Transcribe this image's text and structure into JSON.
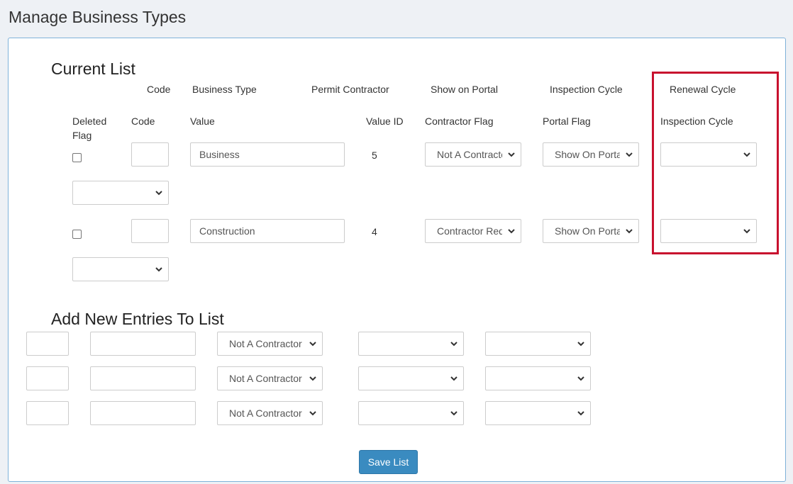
{
  "page": {
    "title": "Manage Business Types"
  },
  "current_list": {
    "title": "Current List",
    "header_row1": [
      "Code",
      "Business Type",
      "Permit Contractor",
      "Show on Portal",
      "Inspection Cycle",
      "Renewal Cycle"
    ],
    "header_row2": [
      "Deleted\nFlag",
      "Code",
      "Value",
      "Value ID",
      "Contractor Flag",
      "Portal Flag",
      "Inspection Cycle"
    ],
    "rows": [
      {
        "deleted": false,
        "code": "",
        "value": "Business",
        "value_id": "5",
        "contractor_flag": "Not A Contractor",
        "portal_flag": "Show On Portal",
        "inspection_cycle": "",
        "renewal_cycle": ""
      },
      {
        "deleted": false,
        "code": "",
        "value": "Construction",
        "value_id": "4",
        "contractor_flag": "Contractor Required",
        "portal_flag": "Show On Portal",
        "inspection_cycle": "",
        "renewal_cycle": ""
      }
    ]
  },
  "add_new": {
    "title": "Add New Entries To List",
    "rows": [
      {
        "code": "",
        "value": "",
        "contractor_flag": "Not A Contractor",
        "portal_flag": "",
        "inspection_cycle": ""
      },
      {
        "code": "",
        "value": "",
        "contractor_flag": "Not A Contractor",
        "portal_flag": "",
        "inspection_cycle": ""
      },
      {
        "code": "",
        "value": "",
        "contractor_flag": "Not A Contractor",
        "portal_flag": "",
        "inspection_cycle": ""
      }
    ]
  },
  "actions": {
    "save_label": "Save List"
  },
  "colors": {
    "highlight": "#c8102e",
    "button": "#3a8bc0",
    "panel_border": "#7fb2d9"
  },
  "icons": {
    "select_arrow": "chevron-down-icon"
  }
}
